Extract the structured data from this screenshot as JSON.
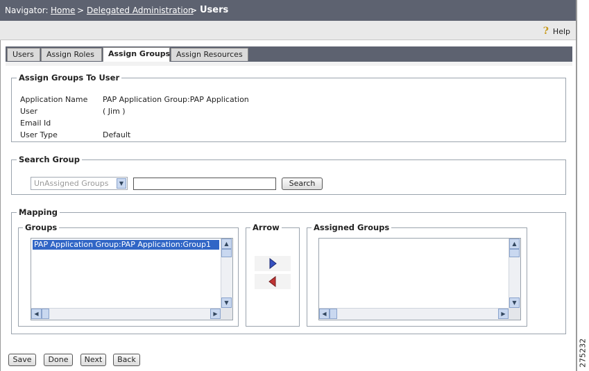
{
  "navigator": {
    "label": "Navigator:",
    "breadcrumb": [
      "Home",
      "Delegated Administration"
    ],
    "separator": ">",
    "current": "Users"
  },
  "toolbar": {
    "help_label": "Help",
    "help_icon": "question-mark-icon"
  },
  "tabs": [
    {
      "label": "Users",
      "active": false
    },
    {
      "label": "Assign Roles",
      "active": false
    },
    {
      "label": "Assign Groups",
      "active": true
    },
    {
      "label": "Assign Resources",
      "active": false
    }
  ],
  "assign_section": {
    "title": "Assign Groups To User",
    "fields": [
      {
        "label": "Application Name",
        "value": "PAP Application Group:PAP Application"
      },
      {
        "label": "User",
        "value": "( Jim )"
      },
      {
        "label": "Email Id",
        "value": ""
      },
      {
        "label": "User Type",
        "value": "Default"
      }
    ]
  },
  "search_section": {
    "title": "Search Group",
    "select_value": "UnAssigned Groups",
    "input_value": "",
    "search_label": "Search"
  },
  "mapping": {
    "title": "Mapping",
    "groups_title": "Groups",
    "groups_items": [
      "PAP Application Group:PAP Application:Group1"
    ],
    "arrow_title": "Arrow",
    "assigned_title": "Assigned Groups",
    "assigned_items": [],
    "colors": {
      "right_arrow": "#3550c0",
      "left_arrow": "#c03535",
      "selection": "#3166c6"
    }
  },
  "footer": {
    "save": "Save",
    "done": "Done",
    "next": "Next",
    "back": "Back"
  },
  "figure_id": "275232"
}
